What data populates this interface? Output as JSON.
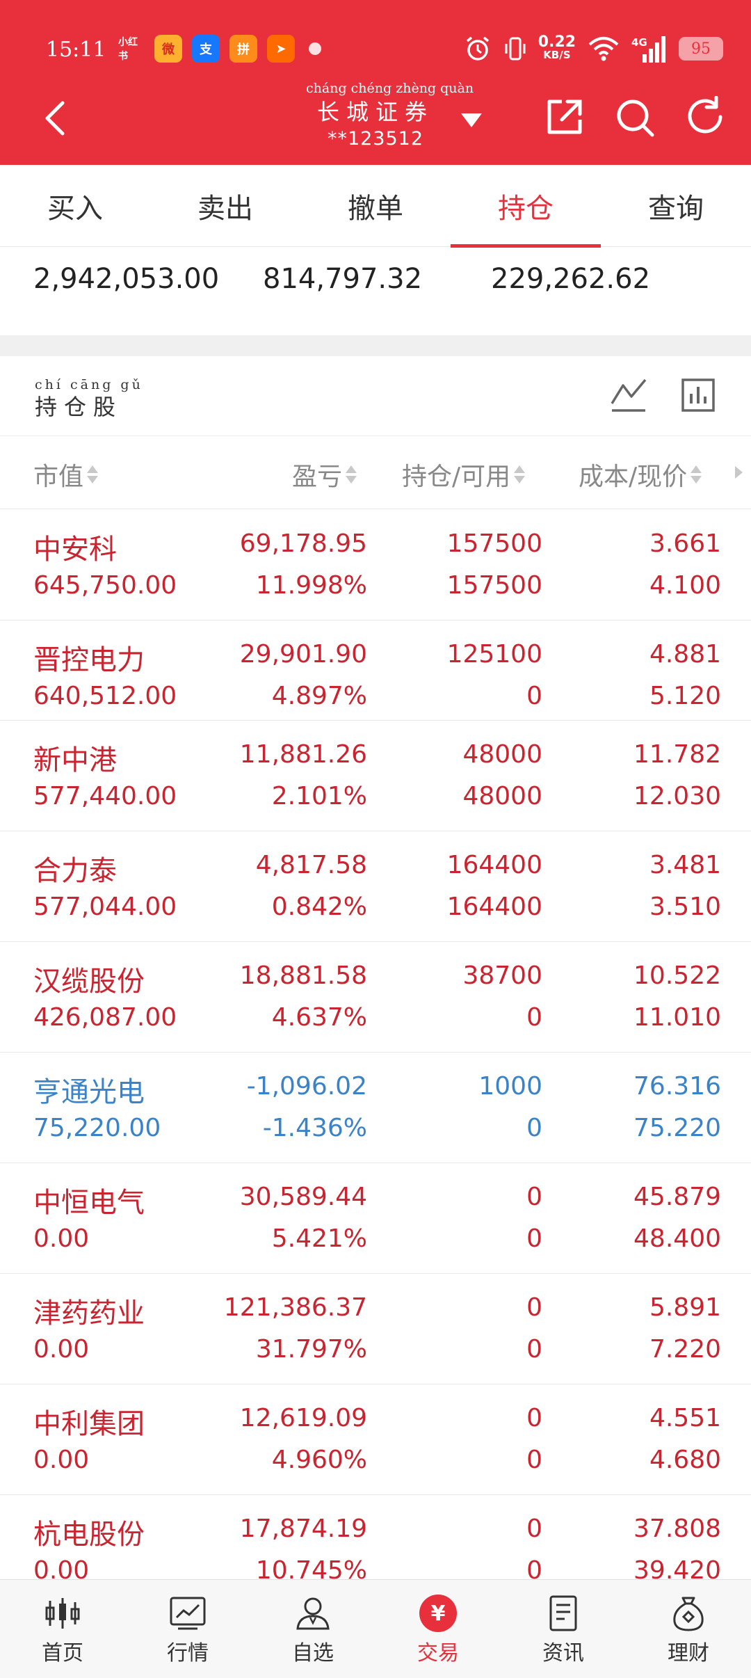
{
  "status_bar": {
    "time": "15:11",
    "net_speed": "0.22",
    "net_unit": "KB/S",
    "network_type": "4G",
    "battery": "95",
    "app_icons": [
      "xiaohongshu-icon",
      "weibo-icon",
      "alipay-icon",
      "pinduoduo-icon",
      "telegram-like-icon"
    ]
  },
  "header": {
    "broker_pinyin": "cháng chéng zhèng quàn",
    "broker_name": "长城证券",
    "account": "**123512"
  },
  "tabs": [
    {
      "label": "买入",
      "active": false
    },
    {
      "label": "卖出",
      "active": false
    },
    {
      "label": "撤单",
      "active": false
    },
    {
      "label": "持仓",
      "active": true
    },
    {
      "label": "查询",
      "active": false
    }
  ],
  "summary": {
    "v1": "2,942,053.00",
    "v2": "814,797.32",
    "v3": "229,262.62"
  },
  "section": {
    "title_pinyin": "chí cāng gǔ",
    "title": "持仓股"
  },
  "columns": {
    "market_value": "市值",
    "profit_loss": "盈亏",
    "position": "持仓/可用",
    "cost_price": "成本/现价"
  },
  "holdings": [
    {
      "name": "中安科",
      "market_value": "645,750.00",
      "pl": "69,178.95",
      "pl_pct": "11.998%",
      "position": "157500",
      "available": "157500",
      "cost": "3.661",
      "price": "4.100",
      "trend": "up"
    },
    {
      "name": "晋控电力",
      "market_value": "640,512.00",
      "pl": "29,901.90",
      "pl_pct": "4.897%",
      "position": "125100",
      "available": "0",
      "cost": "4.881",
      "price": "5.120",
      "trend": "up"
    },
    {
      "name": "新中港",
      "market_value": "577,440.00",
      "pl": "11,881.26",
      "pl_pct": "2.101%",
      "position": "48000",
      "available": "48000",
      "cost": "11.782",
      "price": "12.030",
      "trend": "up"
    },
    {
      "name": "合力泰",
      "market_value": "577,044.00",
      "pl": "4,817.58",
      "pl_pct": "0.842%",
      "position": "164400",
      "available": "164400",
      "cost": "3.481",
      "price": "3.510",
      "trend": "up"
    },
    {
      "name": "汉缆股份",
      "market_value": "426,087.00",
      "pl": "18,881.58",
      "pl_pct": "4.637%",
      "position": "38700",
      "available": "0",
      "cost": "10.522",
      "price": "11.010",
      "trend": "up"
    },
    {
      "name": "亨通光电",
      "market_value": "75,220.00",
      "pl": "-1,096.02",
      "pl_pct": "-1.436%",
      "position": "1000",
      "available": "0",
      "cost": "76.316",
      "price": "75.220",
      "trend": "down"
    },
    {
      "name": "中恒电气",
      "market_value": "0.00",
      "pl": "30,589.44",
      "pl_pct": "5.421%",
      "position": "0",
      "available": "0",
      "cost": "45.879",
      "price": "48.400",
      "trend": "up"
    },
    {
      "name": "津药药业",
      "market_value": "0.00",
      "pl": "121,386.37",
      "pl_pct": "31.797%",
      "position": "0",
      "available": "0",
      "cost": "5.891",
      "price": "7.220",
      "trend": "up"
    },
    {
      "name": "中利集团",
      "market_value": "0.00",
      "pl": "12,619.09",
      "pl_pct": "4.960%",
      "position": "0",
      "available": "0",
      "cost": "4.551",
      "price": "4.680",
      "trend": "up"
    },
    {
      "name": "杭电股份",
      "market_value": "0.00",
      "pl": "17,874.19",
      "pl_pct": "10.745%",
      "position": "0",
      "available": "0",
      "cost": "37.808",
      "price": "39.420",
      "trend": "up"
    }
  ],
  "bottom_nav": [
    {
      "label": "首页",
      "icon": "candlestick-icon",
      "active": false
    },
    {
      "label": "行情",
      "icon": "chart-icon",
      "active": false
    },
    {
      "label": "自选",
      "icon": "person-icon",
      "active": false
    },
    {
      "label": "交易",
      "icon": "yuan-icon",
      "active": true,
      "glyph": "¥"
    },
    {
      "label": "资讯",
      "icon": "document-icon",
      "active": false
    },
    {
      "label": "理财",
      "icon": "moneybag-icon",
      "active": false
    }
  ],
  "colors": {
    "brand_red": "#e7303c",
    "gain_red": "#c9242f",
    "loss_blue": "#3a83c9"
  }
}
